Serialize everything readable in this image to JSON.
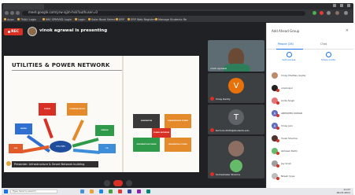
{
  "browser": {
    "url": "meet.google.com/yrw-ajjm-hsk?authuser=0",
    "bookmarks": [
      {
        "label": "Apps"
      },
      {
        "label": "TNAU Login"
      },
      {
        "label": "IMU SPMVKD Login"
      },
      {
        "label": "Login"
      },
      {
        "label": "Solar Book Select"
      },
      {
        "label": "ERP"
      },
      {
        "label": "ERP Web Register"
      },
      {
        "label": "Manage Students Re"
      }
    ]
  },
  "meet": {
    "rec_label": "REC",
    "presenting_text": "vinok agrawal is presenting",
    "colors": {
      "rec": "#d93025",
      "accent": "#1a73e8",
      "background": "#202124"
    }
  },
  "slide": {
    "title": "UTILITIES & POWER NETWORK",
    "hub_label": "UTILITIES",
    "left_boxes": [
      {
        "label": "WATER",
        "color": "#2f6fd1"
      },
      {
        "label": "POWER",
        "color": "#d93025"
      },
      {
        "label": "COMMUNICATION",
        "color": "#e58a2b"
      },
      {
        "label": "SEWAGE",
        "color": "#2e9a4a"
      },
      {
        "label": "GAS",
        "color": "#e05a2a"
      },
      {
        "label": "OIL",
        "color": "#3d8dd9"
      }
    ],
    "right_boxes": [
      {
        "label": "GENERATION",
        "color": "#3a3a3a"
      },
      {
        "label": "TRANSMISSION POWER",
        "color": "#e58a2b"
      },
      {
        "label": "DISTRIBUTION POWER",
        "color": "#2e9a4a"
      },
      {
        "label": "RESIDENTIAL POWER",
        "color": "#e58a2b"
      },
      {
        "label": "POWER NETWORK",
        "color": "#d93025"
      }
    ],
    "caption": "Presenter: Infrastructure & Smart Network building"
  },
  "tiles": [
    {
      "name": "vinok agrawal",
      "type": "camera"
    },
    {
      "name": "Vinay Reddy",
      "initial": "V",
      "color": "#e8710a"
    },
    {
      "name": "tel.Suni.2020@students.edu",
      "initial": "T",
      "color": "#5f6368"
    },
    {
      "name": "Jeni Jayakanth",
      "initial": "",
      "color": "#8d6e63"
    },
    {
      "name": "Somashekar Sharma",
      "initial": "",
      "color": "#66bb6a"
    }
  ],
  "panel": {
    "title": "Add Ahead Group",
    "tabs": [
      "People (28)",
      "Chat"
    ],
    "actions": [
      "Add people",
      "Share invite"
    ],
    "participants": [
      {
        "name": "Vinay Madhav Gupta",
        "initial": "",
        "color": "#bf8a6a"
      },
      {
        "name": "vinokrajul",
        "initial": "",
        "color": "#212121"
      },
      {
        "name": "Anita Singh",
        "initial": "",
        "color": "#e57373"
      },
      {
        "name": "ABHISHEK KUMAR",
        "initial": "A",
        "color": "#5c6bc0"
      },
      {
        "name": "Vinay Jain",
        "initial": "A",
        "color": "#5c6bc0"
      },
      {
        "name": "Vivek Sharma",
        "initial": "",
        "color": "#4e342e"
      },
      {
        "name": "Abhisek Padhi",
        "initial": "",
        "color": "#66bb6a"
      },
      {
        "name": "Jay Krish",
        "initial": "",
        "color": "#9e9e9e"
      },
      {
        "name": "Nilesh Vyas",
        "initial": "",
        "color": "#bdbdbd"
      }
    ]
  },
  "taskbar": {
    "search_placeholder": "Type here to search",
    "time": "11:27",
    "date": "06-03-2021"
  }
}
